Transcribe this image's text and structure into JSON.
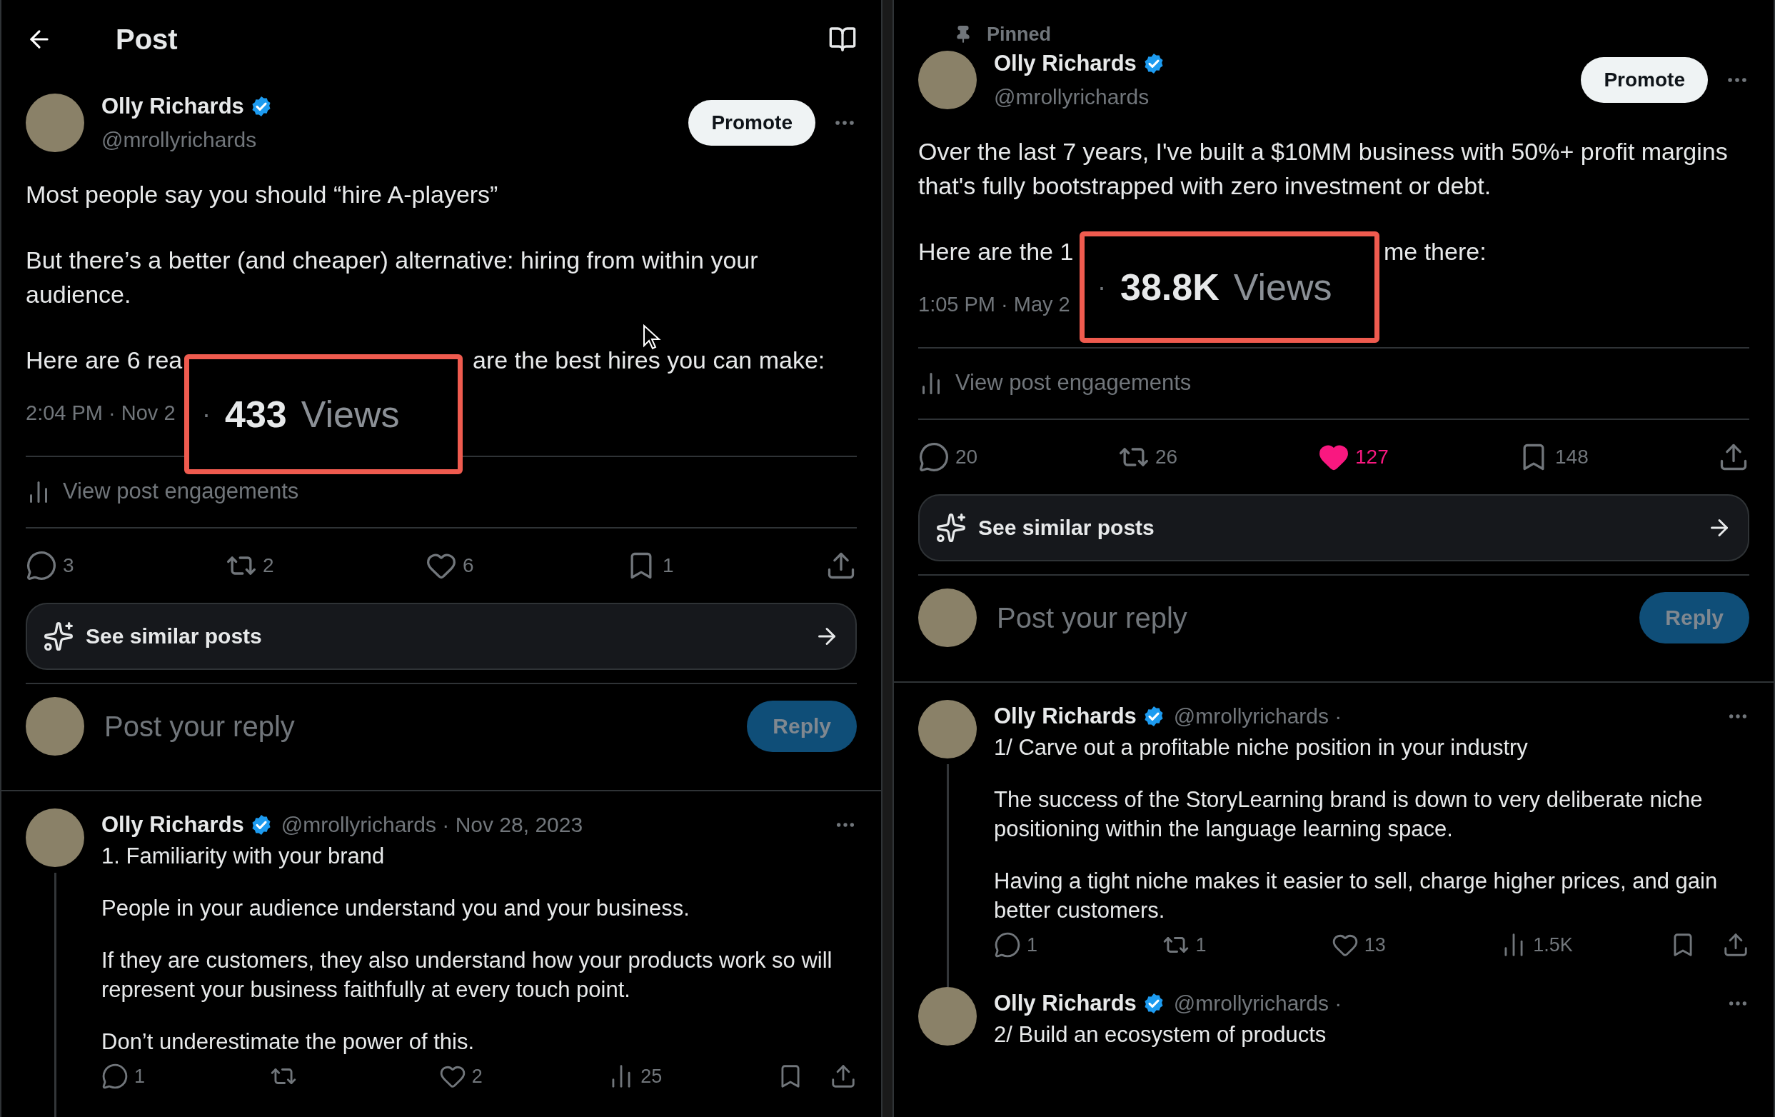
{
  "panels": [
    {
      "header": {
        "title": "Post"
      },
      "post": {
        "author": "Olly Richards",
        "verified": true,
        "handle": "@mrollyrichards",
        "promote": "Promote",
        "paragraphs": [
          "Most people say you should “hire A-players”",
          "But there’s a better (and cheaper) alternative: hiring from within your audience."
        ],
        "covered_line": [
          "Here are 6 rea",
          "are the best hires you can make:"
        ],
        "time": "2:04 PM · Nov 2",
        "callout": {
          "dot": "·",
          "count": "433",
          "label": "Views"
        },
        "engagements": "View post engagements",
        "stats": [
          {
            "kind": "reply",
            "count": "3",
            "active": false
          },
          {
            "kind": "repost",
            "count": "2",
            "active": false
          },
          {
            "kind": "like",
            "count": "6",
            "active": false
          },
          {
            "kind": "bookmark",
            "count": "1",
            "active": false
          },
          {
            "kind": "share",
            "active": false
          }
        ]
      },
      "similar": "See similar posts",
      "composer": {
        "placeholder": "Post your reply",
        "button": "Reply",
        "disabled": true
      },
      "replies": [
        {
          "author": "Olly Richards",
          "verified": true,
          "handle": "@mrollyrichards · Nov 28, 2023",
          "thread": true,
          "paragraphs": [
            "1. Familiarity with your brand",
            "People in your audience understand you and your business.",
            "If they are customers, they also understand how your products work so will represent your business faithfully at every touch point.",
            "Don’t underestimate the power of this."
          ],
          "stats": [
            {
              "kind": "reply",
              "count": "1",
              "active": false
            },
            {
              "kind": "repost",
              "active": false
            },
            {
              "kind": "like",
              "count": "2",
              "active": false
            },
            {
              "kind": "views",
              "count": "25",
              "active": false
            },
            {
              "kind": "bookmark",
              "active": false
            },
            {
              "kind": "share",
              "active": false
            }
          ]
        }
      ],
      "cursor": true
    },
    {
      "pinned": "Pinned",
      "post": {
        "author": "Olly Richards",
        "verified": true,
        "handle": "@mrollyrichards",
        "promote": "Promote",
        "paragraphs": [
          "Over the last 7 years, I've built a $10MM business with 50%+ profit margins that's fully bootstrapped with zero investment or debt."
        ],
        "covered_line": [
          "Here are the 1",
          "me there:"
        ],
        "time": "1:05 PM · May 2",
        "callout": {
          "dot": "·",
          "count": "38.8K",
          "label": "Views"
        },
        "engagements": "View post engagements",
        "stats": [
          {
            "kind": "reply",
            "count": "20",
            "active": false
          },
          {
            "kind": "repost",
            "count": "26",
            "active": false
          },
          {
            "kind": "like",
            "count": "127",
            "active": true
          },
          {
            "kind": "bookmark",
            "count": "148",
            "active": false
          },
          {
            "kind": "share",
            "active": false
          }
        ]
      },
      "similar": "See similar posts",
      "composer": {
        "placeholder": "Post your reply",
        "button": "Reply",
        "disabled": true
      },
      "replies": [
        {
          "author": "Olly Richards",
          "verified": true,
          "handle": "@mrollyrichards ·",
          "thread": true,
          "paragraphs": [
            "1/  Carve out a profitable niche position in your industry",
            "The success of the StoryLearning brand is down to very deliberate niche positioning within the language learning space.",
            "Having a tight niche makes it easier to sell, charge higher prices, and gain better customers."
          ],
          "stats": [
            {
              "kind": "reply",
              "count": "1",
              "active": false
            },
            {
              "kind": "repost",
              "count": "1",
              "active": false
            },
            {
              "kind": "like",
              "count": "13",
              "active": false
            },
            {
              "kind": "views",
              "count": "1.5K",
              "active": false
            },
            {
              "kind": "bookmark",
              "active": false
            },
            {
              "kind": "share",
              "active": false
            }
          ]
        },
        {
          "author": "Olly Richards",
          "verified": true,
          "handle": "@mrollyrichards ·",
          "thread": false,
          "paragraphs": [
            "2/ Build an ecosystem of products"
          ]
        }
      ],
      "cursor": false
    }
  ]
}
